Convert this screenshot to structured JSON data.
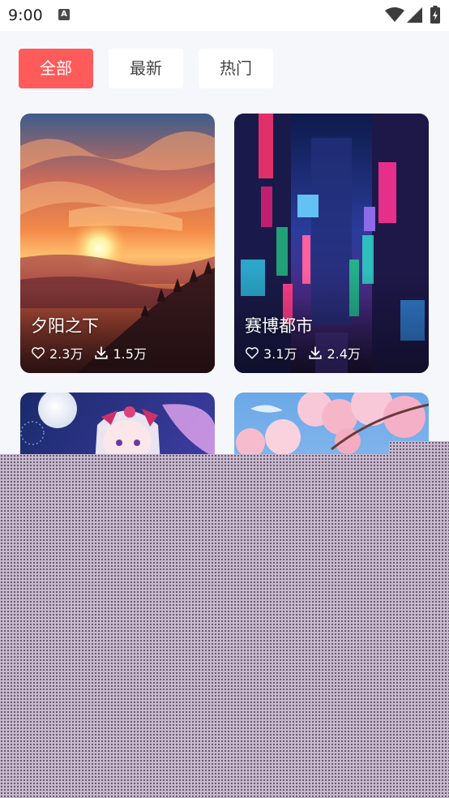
{
  "status_bar": {
    "time": "9:00",
    "notification_icon": "a-badge-icon"
  },
  "tabs": [
    {
      "label": "全部",
      "active": true
    },
    {
      "label": "最新",
      "active": false
    },
    {
      "label": "热门",
      "active": false
    }
  ],
  "wallpapers": [
    {
      "title": "夕阳之下",
      "likes": "2.3万",
      "downloads": "1.5万",
      "theme": "sunset-mountains"
    },
    {
      "title": "赛博都市",
      "likes": "3.1万",
      "downloads": "2.4万",
      "theme": "cyberpunk-city"
    },
    {
      "title": "",
      "theme": "anime-girl-moon"
    },
    {
      "title": "",
      "theme": "cherry-blossom"
    }
  ],
  "colors": {
    "accent": "#ff5b5b",
    "background": "#f6f7fb"
  }
}
